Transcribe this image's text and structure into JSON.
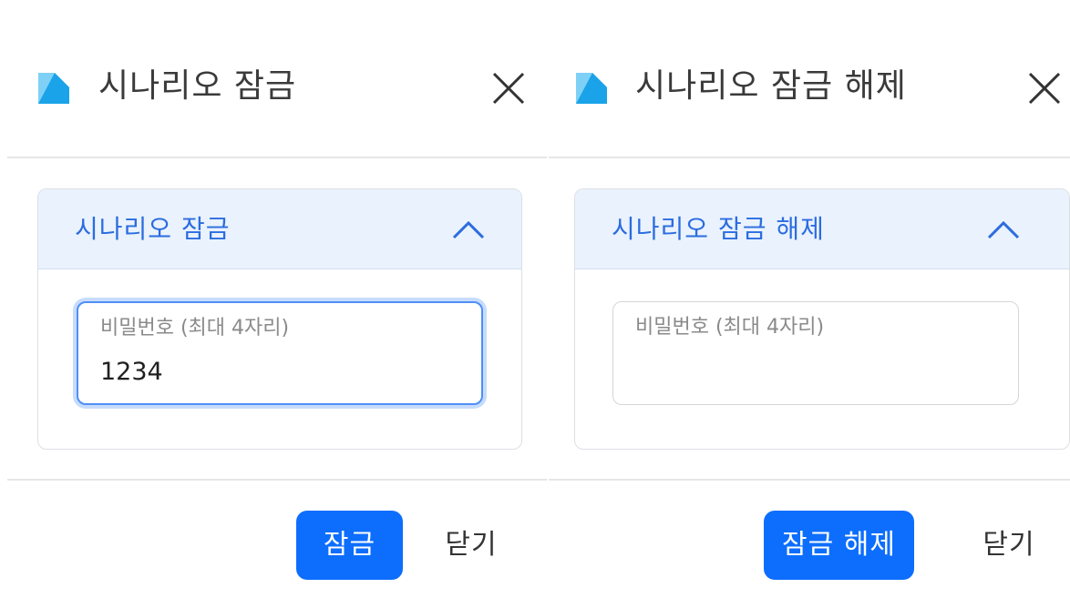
{
  "colors": {
    "accent": "#0d6efd",
    "panel_header_bg": "#eaf2fd",
    "panel_title": "#2b6ce0",
    "focus_ring": "#4f8ff7",
    "icon_light": "#7fd0f7",
    "icon_dark": "#1aa3e8"
  },
  "lock_dialog": {
    "icon": "document-icon",
    "title": "시나리오 잠금",
    "panel_title": "시나리오 잠금",
    "password_label": "비밀번호 (최대 4자리)",
    "password_value": "1234",
    "confirm_label": "잠금",
    "close_label": "닫기"
  },
  "unlock_dialog": {
    "icon": "document-icon",
    "title": "시나리오 잠금 해제",
    "panel_title": "시나리오 잠금 해제",
    "password_label": "비밀번호 (최대 4자리)",
    "password_value": "",
    "confirm_label": "잠금 해제",
    "close_label": "닫기"
  }
}
